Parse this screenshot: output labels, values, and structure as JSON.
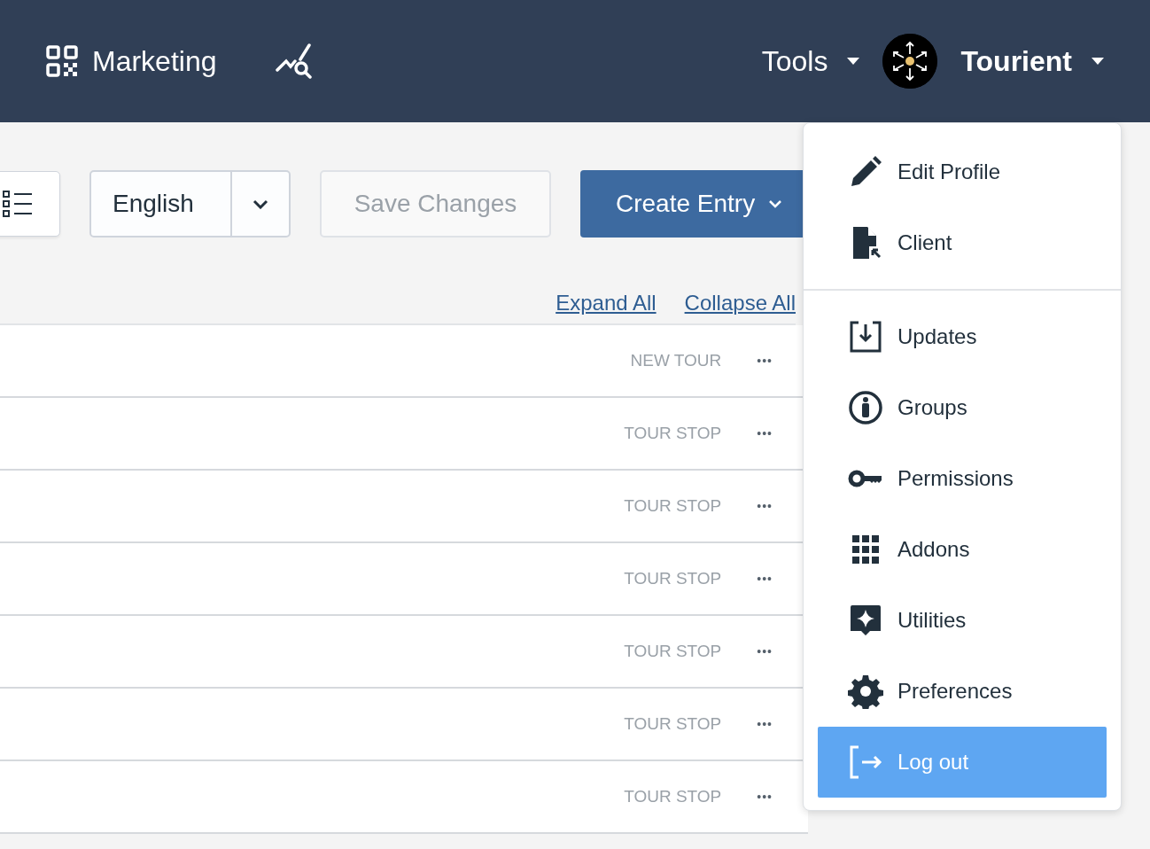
{
  "header": {
    "app_title": "Marketing",
    "tools_label": "Tools",
    "account_name": "Tourient"
  },
  "toolbar": {
    "language": "English",
    "save_button": {
      "label": "Save Changes",
      "disabled": true
    },
    "create_button": "Create Entry"
  },
  "links": [
    "Expand All",
    "Collapse All"
  ],
  "rows": [
    {
      "type_label": "NEW TOUR",
      "menu": "•••"
    },
    {
      "type_label": "TOUR STOP",
      "menu": "•••"
    },
    {
      "type_label": "TOUR STOP",
      "menu": "•••"
    },
    {
      "type_label": "TOUR STOP",
      "menu": "•••"
    },
    {
      "type_label": "TOUR STOP",
      "menu": "•••"
    },
    {
      "type_label": "TOUR STOP",
      "menu": "•••"
    },
    {
      "type_label": "TOUR STOP",
      "menu": "•••"
    }
  ],
  "user_menu": {
    "sections": [
      [
        {
          "label": "Edit Profile",
          "selected": false
        },
        {
          "label": "Client",
          "selected": false
        }
      ],
      [
        {
          "label": "Updates",
          "selected": false
        },
        {
          "label": "Groups",
          "selected": false
        },
        {
          "label": "Permissions",
          "selected": false
        },
        {
          "label": "Addons",
          "selected": false
        },
        {
          "label": "Utilities",
          "selected": false
        },
        {
          "label": "Preferences",
          "selected": false
        },
        {
          "label": "Log out",
          "selected": true
        }
      ]
    ]
  }
}
